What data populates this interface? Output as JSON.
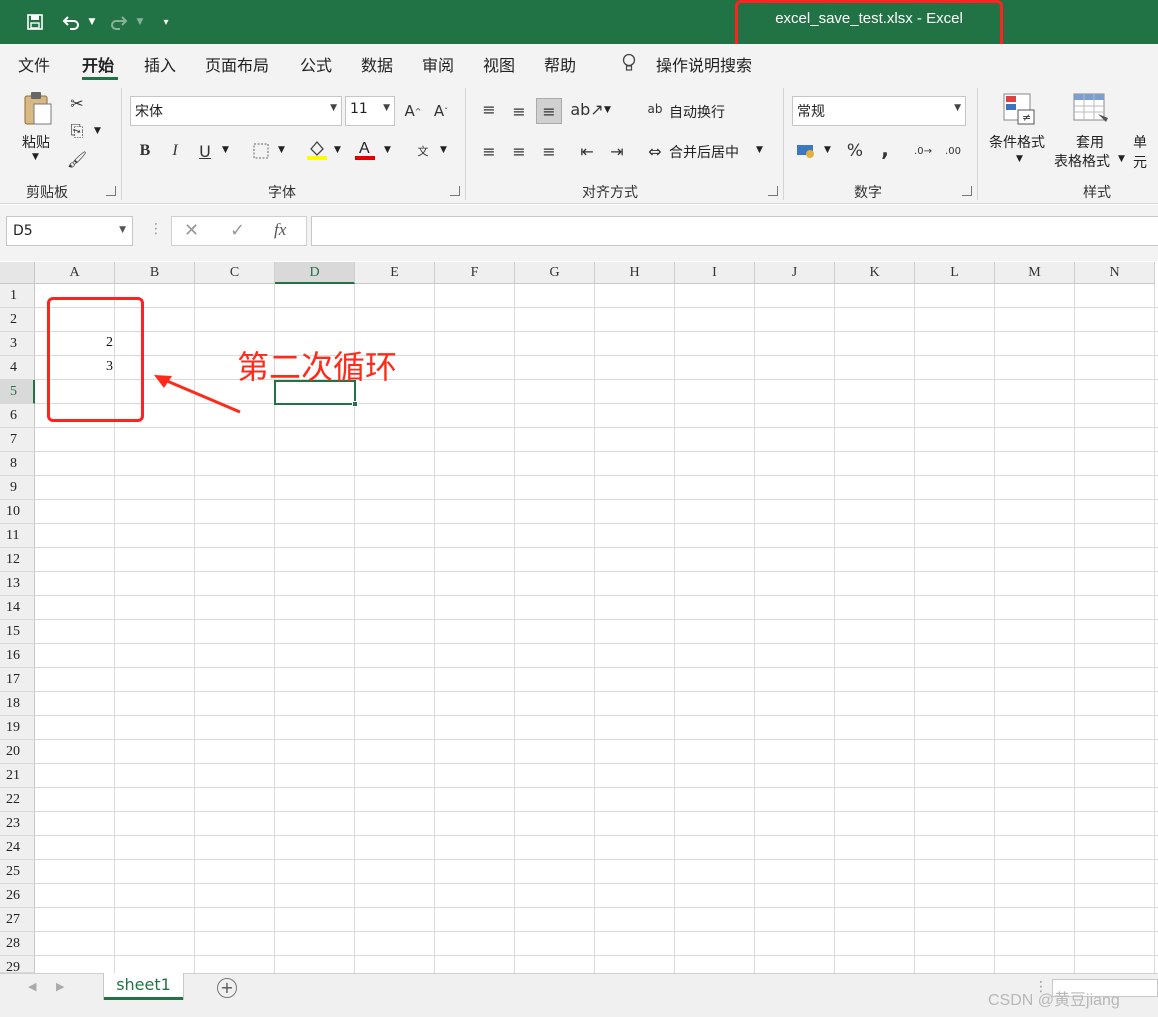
{
  "window": {
    "title": "excel_save_test.xlsx  -  Excel"
  },
  "tabs": [
    "文件",
    "开始",
    "插入",
    "页面布局",
    "公式",
    "数据",
    "审阅",
    "视图",
    "帮助"
  ],
  "tell_me": "操作说明搜索",
  "ribbon": {
    "clipboard": {
      "paste": "粘贴",
      "group": "剪贴板"
    },
    "font": {
      "name": "宋体",
      "size": "11",
      "group": "字体",
      "bold": "B",
      "italic": "I",
      "underline": "U"
    },
    "alignment": {
      "wrap": "自动换行",
      "merge": "合并后居中",
      "group": "对齐方式"
    },
    "number": {
      "format": "常规",
      "percent": "%",
      "comma": ",",
      "group": "数字"
    },
    "styles": {
      "conditional": "条件格式",
      "table_1": "套用",
      "table_2": "表格格式",
      "cell": "单元",
      "group": "样式"
    }
  },
  "formula_bar": {
    "name_box": "D5",
    "fx": "fx",
    "value": ""
  },
  "columns": [
    "A",
    "B",
    "C",
    "D",
    "E",
    "F",
    "G",
    "H",
    "I",
    "J",
    "K",
    "L",
    "M",
    "N"
  ],
  "rows": [
    "1",
    "2",
    "3",
    "4",
    "5",
    "6",
    "7",
    "8",
    "9",
    "10",
    "11",
    "12",
    "13",
    "14",
    "15",
    "16",
    "17",
    "18",
    "19",
    "20",
    "21",
    "22",
    "23",
    "24",
    "25",
    "26",
    "27",
    "28",
    "29"
  ],
  "cells": [
    {
      "ref": "A3",
      "value": "2"
    },
    {
      "ref": "A4",
      "value": "3"
    }
  ],
  "selected": {
    "column": "D",
    "row": "5"
  },
  "annotation": "第二次循环",
  "sheet_tab": "sheet1",
  "watermark": "CSDN @黄豆jiang",
  "colors": {
    "accent": "#217346",
    "annotation": "#ff2222"
  }
}
